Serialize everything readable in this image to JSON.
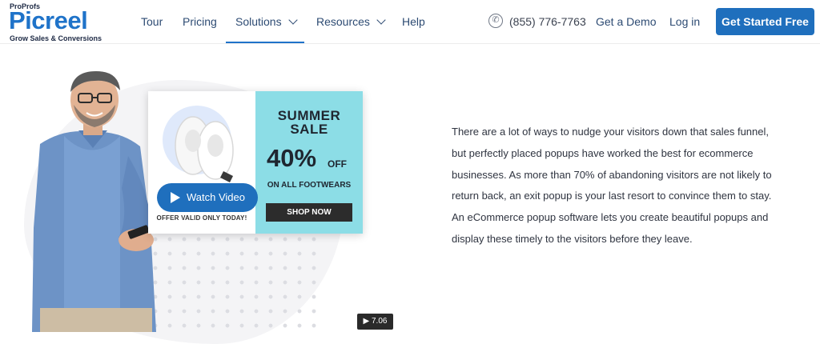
{
  "brand": {
    "top_label": "ProProfs",
    "name": "Picreel",
    "tagline": "Grow Sales & Conversions",
    "color": "#1f73c9"
  },
  "nav": {
    "items": [
      {
        "label": "Tour"
      },
      {
        "label": "Pricing"
      },
      {
        "label": "Solutions",
        "active": true,
        "has_dropdown": true
      },
      {
        "label": "Resources",
        "has_dropdown": true
      },
      {
        "label": "Help"
      }
    ],
    "phone": "(855) 776-7763",
    "phone_icon": "phone-icon",
    "demo": "Get a Demo",
    "login": "Log in",
    "cta": "Get Started Free",
    "cta_color": "#1f6fbd"
  },
  "hero": {
    "popup": {
      "title_line1": "SUMMER",
      "title_line2": "SALE",
      "percent": "40%",
      "off": "OFF",
      "subtitle": "ON ALL FOOTWEARS",
      "shop_button": "SHOP NOW",
      "offer_note": "OFFER VALID ONLY TODAY!",
      "accent_color": "#8cdde6"
    },
    "watch_video": "Watch Video",
    "video_duration": "▶ 7.06",
    "description": "There are a lot of ways to nudge your visitors down that sales funnel, but perfectly placed popups have worked the best for ecommerce businesses. As more than 70% of abandoning visitors are not likely to return back, an exit popup is your last resort to convince them to stay. An eCommerce popup software lets you create beautiful popups and display these timely to the visitors before they leave."
  }
}
